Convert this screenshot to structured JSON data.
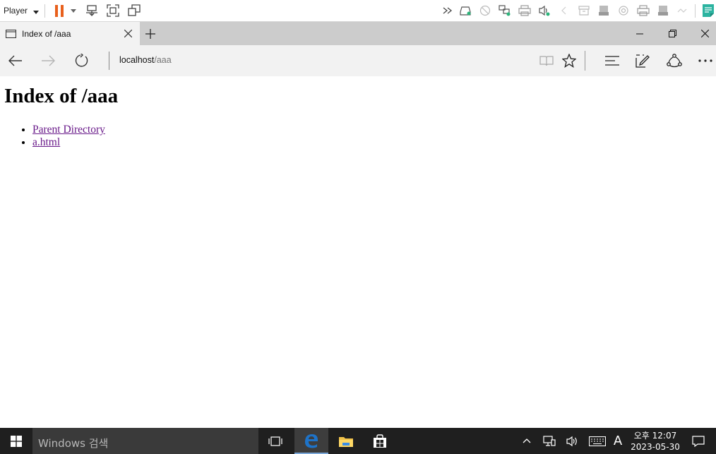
{
  "player_bar": {
    "menu_label": "Player",
    "accent_pause": "#e8601c",
    "accent_note": "#2bb3a0"
  },
  "browser": {
    "tab_title": "Index of /aaa",
    "address": {
      "host": "localhost",
      "path": "/aaa"
    }
  },
  "page": {
    "heading": "Index of /aaa",
    "links": [
      {
        "label": "Parent Directory"
      },
      {
        "label": "a.html"
      }
    ],
    "link_color": "#6a1b8a"
  },
  "taskbar": {
    "search_placeholder": "Windows 검색",
    "ime_label": "A",
    "clock": {
      "time": "오후 12:07",
      "date": "2023-05-30"
    },
    "edge_color": "#1e73c8"
  }
}
